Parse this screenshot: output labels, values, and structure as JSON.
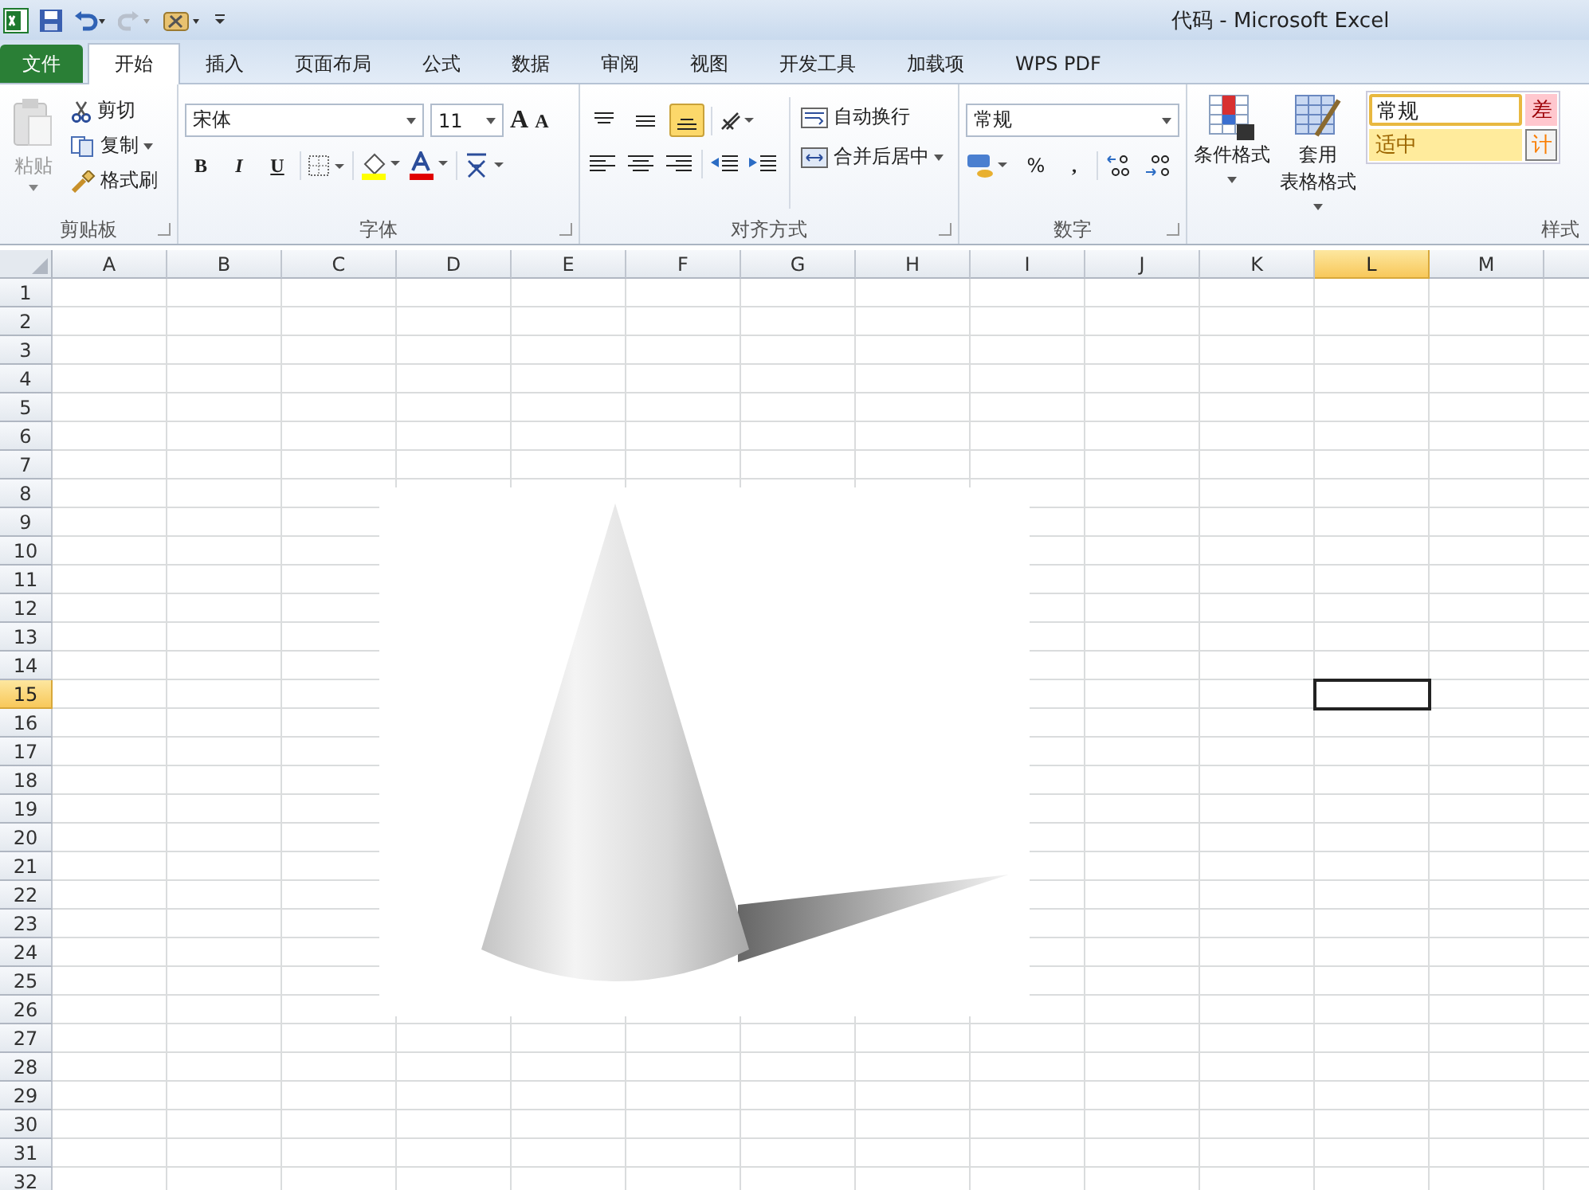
{
  "window": {
    "title": "代码  -  Microsoft Excel"
  },
  "file_menu": "文件",
  "tabs": [
    {
      "label": "开始",
      "selected": true
    },
    {
      "label": "插入",
      "selected": false
    },
    {
      "label": "页面布局",
      "selected": false
    },
    {
      "label": "公式",
      "selected": false
    },
    {
      "label": "数据",
      "selected": false
    },
    {
      "label": "审阅",
      "selected": false
    },
    {
      "label": "视图",
      "selected": false
    },
    {
      "label": "开发工具",
      "selected": false
    },
    {
      "label": "加载项",
      "selected": false
    },
    {
      "label": "WPS PDF",
      "selected": false
    }
  ],
  "clipboard": {
    "label": "剪贴板",
    "paste": {
      "label": "粘贴",
      "disabled": true
    },
    "cut": "剪切",
    "copy": "复制",
    "format_painter": "格式刷"
  },
  "font": {
    "label": "字体",
    "name": "宋体",
    "size": "11",
    "grow": "A",
    "shrink": "A",
    "bold": "B",
    "italic": "I",
    "underline": "U"
  },
  "alignment": {
    "label": "对齐方式",
    "vertical": [
      {
        "selected": false
      },
      {
        "selected": false
      },
      {
        "selected": true
      }
    ],
    "wrap": "自动换行",
    "merge": "合并后居中"
  },
  "number": {
    "label": "数字",
    "format": "常规",
    "percent": "%",
    "comma": ","
  },
  "styles": {
    "label": "样式",
    "conditional": "条件格式",
    "table_format": [
      "套用",
      "表格格式"
    ],
    "cells": [
      {
        "label": "常规",
        "kind": "normal"
      },
      {
        "label": "差",
        "kind": "bad"
      },
      {
        "label": "适中",
        "kind": "neutral"
      },
      {
        "label": "计",
        "kind": "calc"
      }
    ]
  },
  "columns": [
    {
      "label": "A",
      "selected": false
    },
    {
      "label": "B",
      "selected": false
    },
    {
      "label": "C",
      "selected": false
    },
    {
      "label": "D",
      "selected": false
    },
    {
      "label": "E",
      "selected": false
    },
    {
      "label": "F",
      "selected": false
    },
    {
      "label": "G",
      "selected": false
    },
    {
      "label": "H",
      "selected": false
    },
    {
      "label": "I",
      "selected": false
    },
    {
      "label": "J",
      "selected": false
    },
    {
      "label": "K",
      "selected": false
    },
    {
      "label": "L",
      "selected": true
    },
    {
      "label": "M",
      "selected": false
    }
  ],
  "rows": [
    {
      "label": "1",
      "selected": false
    },
    {
      "label": "2",
      "selected": false
    },
    {
      "label": "3",
      "selected": false
    },
    {
      "label": "4",
      "selected": false
    },
    {
      "label": "5",
      "selected": false
    },
    {
      "label": "6",
      "selected": false
    },
    {
      "label": "7",
      "selected": false
    },
    {
      "label": "8",
      "selected": false
    },
    {
      "label": "9",
      "selected": false
    },
    {
      "label": "10",
      "selected": false
    },
    {
      "label": "11",
      "selected": false
    },
    {
      "label": "12",
      "selected": false
    },
    {
      "label": "13",
      "selected": false
    },
    {
      "label": "14",
      "selected": false
    },
    {
      "label": "15",
      "selected": true
    },
    {
      "label": "16",
      "selected": false
    },
    {
      "label": "17",
      "selected": false
    },
    {
      "label": "18",
      "selected": false
    },
    {
      "label": "19",
      "selected": false
    },
    {
      "label": "20",
      "selected": false
    },
    {
      "label": "21",
      "selected": false
    },
    {
      "label": "22",
      "selected": false
    },
    {
      "label": "23",
      "selected": false
    },
    {
      "label": "24",
      "selected": false
    },
    {
      "label": "25",
      "selected": false
    },
    {
      "label": "26",
      "selected": false
    },
    {
      "label": "27",
      "selected": false
    },
    {
      "label": "28",
      "selected": false
    },
    {
      "label": "29",
      "selected": false
    },
    {
      "label": "30",
      "selected": false
    },
    {
      "label": "31",
      "selected": false
    },
    {
      "label": "32",
      "selected": false
    }
  ]
}
